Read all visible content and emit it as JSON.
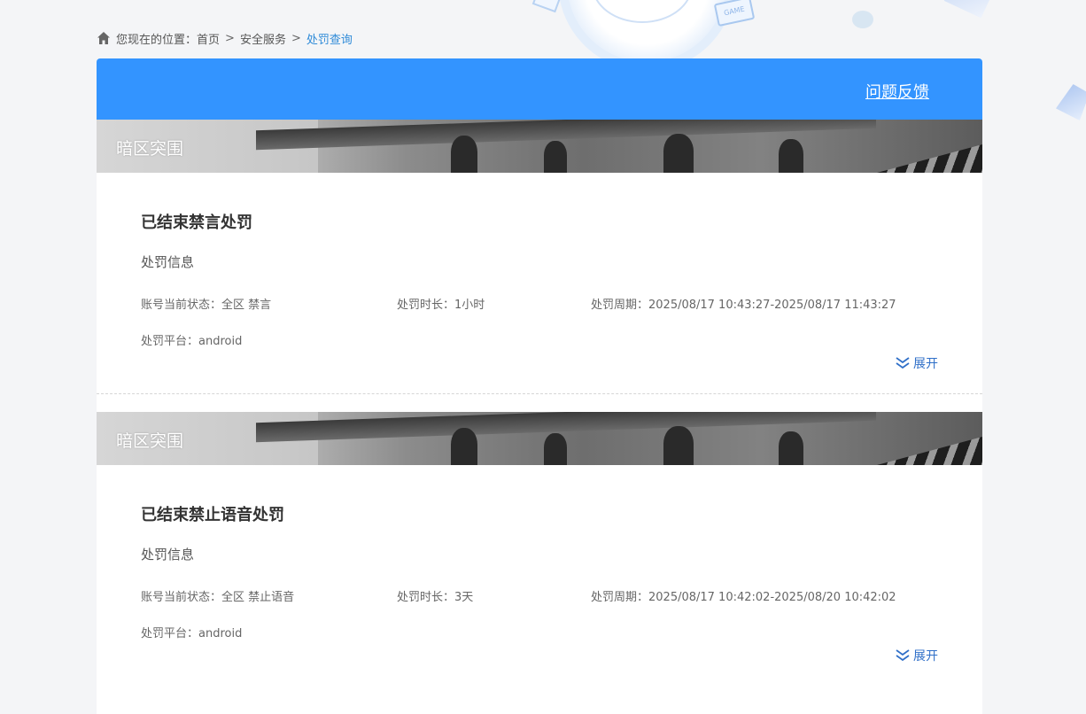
{
  "breadcrumb": {
    "prefix": "您现在的位置：",
    "items": [
      "首页",
      "安全服务"
    ],
    "separator": ">",
    "current": "处罚查询"
  },
  "header": {
    "feedback_label": "问题反馈"
  },
  "records": [
    {
      "game": "暗区突围",
      "title": "已结束禁言处罚",
      "section_label": "处罚信息",
      "status": "账号当前状态：全区 禁言",
      "duration": "处罚时长：1小时",
      "period": "处罚周期：2025/08/17 10:43:27-2025/08/17 11:43:27",
      "platform": "处罚平台：android",
      "expand_label": "展开"
    },
    {
      "game": "暗区突围",
      "title": "已结束禁止语音处罚",
      "section_label": "处罚信息",
      "status": "账号当前状态：全区 禁止语音",
      "duration": "处罚时长：3天",
      "period": "处罚周期：2025/08/17 10:42:02-2025/08/20 10:42:02",
      "platform": "处罚平台：android",
      "expand_label": "展开"
    }
  ],
  "colors": {
    "header_blue": "#3394ff",
    "link_blue": "#2f6fc8",
    "breadcrumb_current": "#2f8bd8"
  },
  "icons": {
    "home": "home-icon",
    "expand": "double-chevron-down-icon"
  }
}
